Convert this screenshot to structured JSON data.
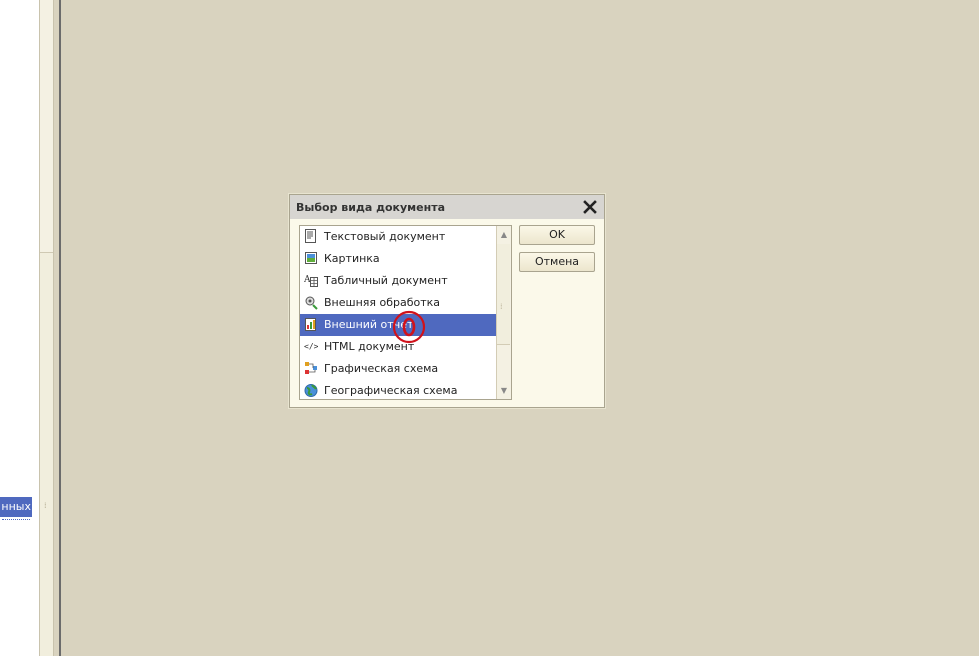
{
  "left_panel": {
    "selected_item_text": "нных"
  },
  "dialog": {
    "title": "Выбор вида документа",
    "items": [
      {
        "label": "Текстовый документ",
        "icon": "text-document-icon"
      },
      {
        "label": "Картинка",
        "icon": "picture-icon"
      },
      {
        "label": "Табличный документ",
        "icon": "spreadsheet-icon"
      },
      {
        "label": "Внешняя обработка",
        "icon": "external-processing-icon"
      },
      {
        "label": "Внешний отчет",
        "icon": "external-report-icon",
        "selected": true
      },
      {
        "label": "HTML документ",
        "icon": "html-document-icon"
      },
      {
        "label": "Графическая схема",
        "icon": "graphic-scheme-icon"
      },
      {
        "label": "Географическая схема",
        "icon": "geographic-scheme-icon"
      }
    ],
    "ok_label": "OK",
    "cancel_label": "Отмена"
  },
  "colors": {
    "selection": "#4f69bf",
    "background": "#d9d3bf",
    "dialog_bg": "#fbf9ea",
    "cursor_marker": "#d0121b"
  }
}
